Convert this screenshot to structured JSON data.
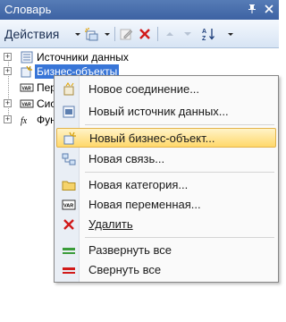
{
  "window": {
    "title": "Словарь",
    "pin_glyph": "ᵽ",
    "close_glyph": "✕"
  },
  "toolbar": {
    "actions_label": "Действия",
    "sort_label": "AZ"
  },
  "tree": {
    "items": [
      {
        "label": "Источники данных",
        "expanded": false
      },
      {
        "label": "Бизнес-объекты",
        "selected": true
      },
      {
        "label": "Пер",
        "truncated": true
      },
      {
        "label": "Сис",
        "truncated": true
      },
      {
        "label": "Фун",
        "truncated": true
      }
    ]
  },
  "context_menu": {
    "items": [
      {
        "label": "Новое соединение..."
      },
      {
        "label": "Новый источник данных..."
      },
      {
        "label": "Новый бизнес-объект...",
        "highlighted": true
      },
      {
        "label": "Новая связь..."
      },
      {
        "label": "Новая категория..."
      },
      {
        "label": "Новая переменная..."
      },
      {
        "label": "Удалить"
      },
      {
        "label": "Развернуть все"
      },
      {
        "label": "Свернуть все"
      }
    ]
  },
  "colors": {
    "titlebar": "#3d62a3",
    "selection": "#3875d7",
    "menu_highlight": "#ffd86a"
  }
}
